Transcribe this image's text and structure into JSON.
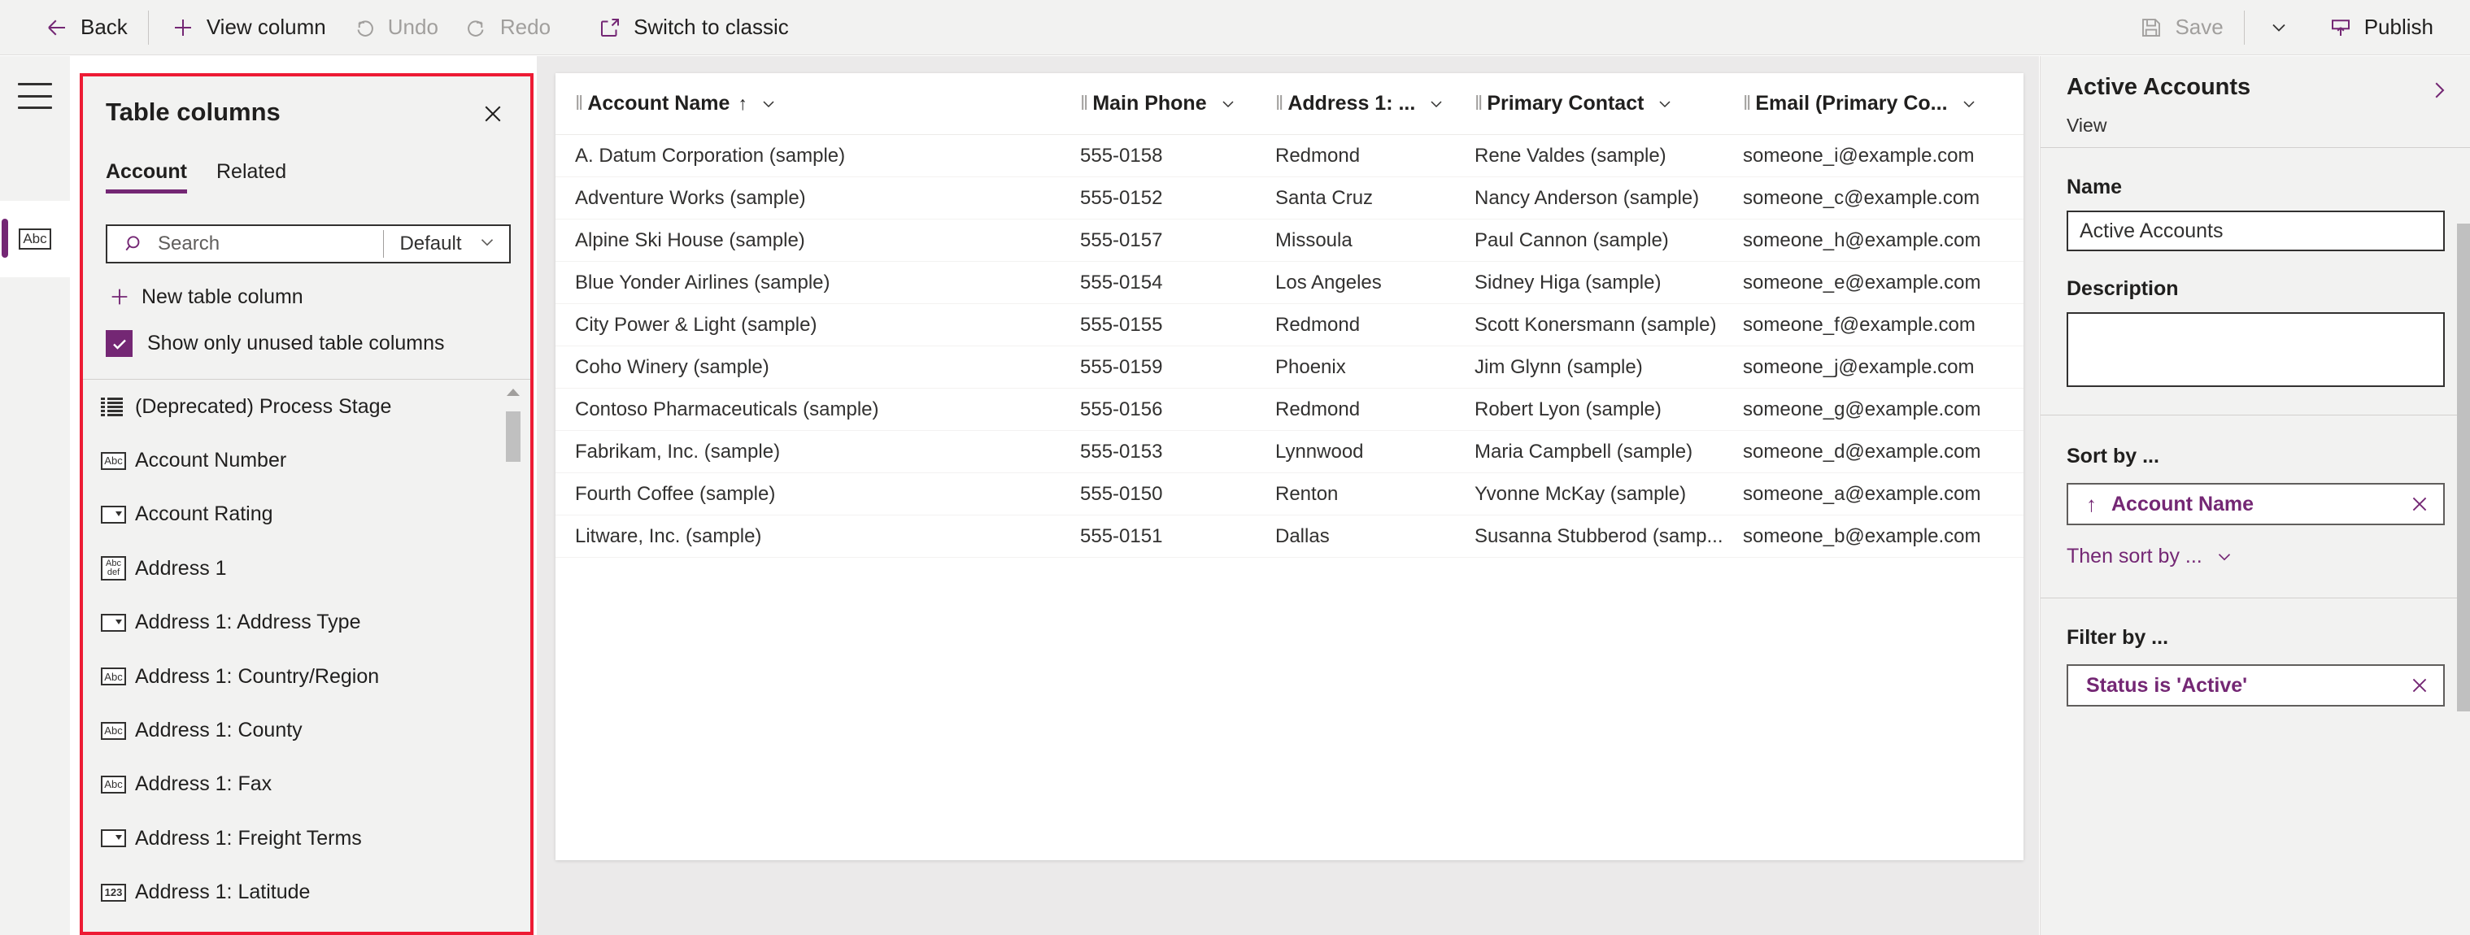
{
  "commandbar": {
    "left_items": [
      {
        "label": "Back",
        "icon": "arrow-left-icon",
        "disabled": false
      },
      {
        "label": "View column",
        "icon": "plus-icon",
        "disabled": false
      },
      {
        "label": "Undo",
        "icon": "undo-icon",
        "disabled": true
      },
      {
        "label": "Redo",
        "icon": "redo-icon",
        "disabled": true
      },
      {
        "label": "Switch to classic",
        "icon": "open-external-icon",
        "disabled": false
      }
    ],
    "right_items": [
      {
        "label": "Save",
        "icon": "save-icon",
        "disabled": true
      },
      {
        "label": "Publish",
        "icon": "publish-icon",
        "disabled": false
      }
    ],
    "save_caret": "chevron-down-icon"
  },
  "leftrail": {
    "menu_icon": "hamburger-icon",
    "selected_item_icon": "abc-textbox-icon",
    "selected_item_label": "Abc"
  },
  "colpanel": {
    "title": "Table columns",
    "close_icon": "close-icon",
    "tabs": [
      {
        "label": "Account",
        "active": true
      },
      {
        "label": "Related",
        "active": false
      }
    ],
    "search": {
      "placeholder": "Search",
      "value": "",
      "icon": "search-icon"
    },
    "scope": {
      "value": "Default",
      "icon": "chevron-down-icon"
    },
    "new_column": {
      "label": "New table column",
      "icon": "plus-icon"
    },
    "show_unused": {
      "label": "Show only unused table columns",
      "checked": true
    },
    "accent_color": "#742774",
    "highlight_color": "#ed1b34",
    "columns": [
      {
        "label": "(Deprecated) Process Stage",
        "icon": "list-icon"
      },
      {
        "label": "Account Number",
        "icon": "abc-textbox-icon"
      },
      {
        "label": "Account Rating",
        "icon": "dropdown-icon"
      },
      {
        "label": "Address 1",
        "icon": "multiline-text-icon"
      },
      {
        "label": "Address 1: Address Type",
        "icon": "dropdown-icon"
      },
      {
        "label": "Address 1: Country/Region",
        "icon": "abc-textbox-icon"
      },
      {
        "label": "Address 1: County",
        "icon": "abc-textbox-icon"
      },
      {
        "label": "Address 1: Fax",
        "icon": "abc-textbox-icon"
      },
      {
        "label": "Address 1: Freight Terms",
        "icon": "dropdown-icon"
      },
      {
        "label": "Address 1: Latitude",
        "icon": "number-icon"
      }
    ]
  },
  "grid": {
    "headers": [
      {
        "label": "Account Name",
        "sorted": true,
        "sort_direction": "ascending",
        "sort_icon": "arrow-up-icon",
        "menu_icon": "chevron-down-icon"
      },
      {
        "label": "Main Phone",
        "sorted": false,
        "menu_icon": "chevron-down-icon"
      },
      {
        "label": "Address 1: ...",
        "sorted": false,
        "menu_icon": "chevron-down-icon"
      },
      {
        "label": "Primary Contact",
        "sorted": false,
        "menu_icon": "chevron-down-icon"
      },
      {
        "label": "Email (Primary Co...",
        "sorted": false,
        "menu_icon": "chevron-down-icon"
      }
    ],
    "rows": [
      [
        "A. Datum Corporation (sample)",
        "555-0158",
        "Redmond",
        "Rene Valdes (sample)",
        "someone_i@example.com"
      ],
      [
        "Adventure Works (sample)",
        "555-0152",
        "Santa Cruz",
        "Nancy Anderson (sample)",
        "someone_c@example.com"
      ],
      [
        "Alpine Ski House (sample)",
        "555-0157",
        "Missoula",
        "Paul Cannon (sample)",
        "someone_h@example.com"
      ],
      [
        "Blue Yonder Airlines (sample)",
        "555-0154",
        "Los Angeles",
        "Sidney Higa (sample)",
        "someone_e@example.com"
      ],
      [
        "City Power & Light (sample)",
        "555-0155",
        "Redmond",
        "Scott Konersmann (sample)",
        "someone_f@example.com"
      ],
      [
        "Coho Winery (sample)",
        "555-0159",
        "Phoenix",
        "Jim Glynn (sample)",
        "someone_j@example.com"
      ],
      [
        "Contoso Pharmaceuticals (sample)",
        "555-0156",
        "Redmond",
        "Robert Lyon (sample)",
        "someone_g@example.com"
      ],
      [
        "Fabrikam, Inc. (sample)",
        "555-0153",
        "Lynnwood",
        "Maria Campbell (sample)",
        "someone_d@example.com"
      ],
      [
        "Fourth Coffee (sample)",
        "555-0150",
        "Renton",
        "Yvonne McKay (sample)",
        "someone_a@example.com"
      ],
      [
        "Litware, Inc. (sample)",
        "555-0151",
        "Dallas",
        "Susanna Stubberod (samp...",
        "someone_b@example.com"
      ]
    ]
  },
  "rightpanel": {
    "title": "Active Accounts",
    "subtitle": "View",
    "expand_icon": "chevron-right-icon",
    "name": {
      "label": "Name",
      "value": "Active Accounts"
    },
    "description": {
      "label": "Description",
      "value": ""
    },
    "sort": {
      "label": "Sort by ...",
      "entry": {
        "text": "Account Name",
        "direction_icon": "arrow-up-icon",
        "remove_icon": "close-icon"
      },
      "then_sort": {
        "label": "Then sort by ...",
        "icon": "chevron-down-icon"
      }
    },
    "filter": {
      "label": "Filter by ...",
      "entry": {
        "text": "Status is 'Active'",
        "remove_icon": "close-icon"
      }
    }
  }
}
